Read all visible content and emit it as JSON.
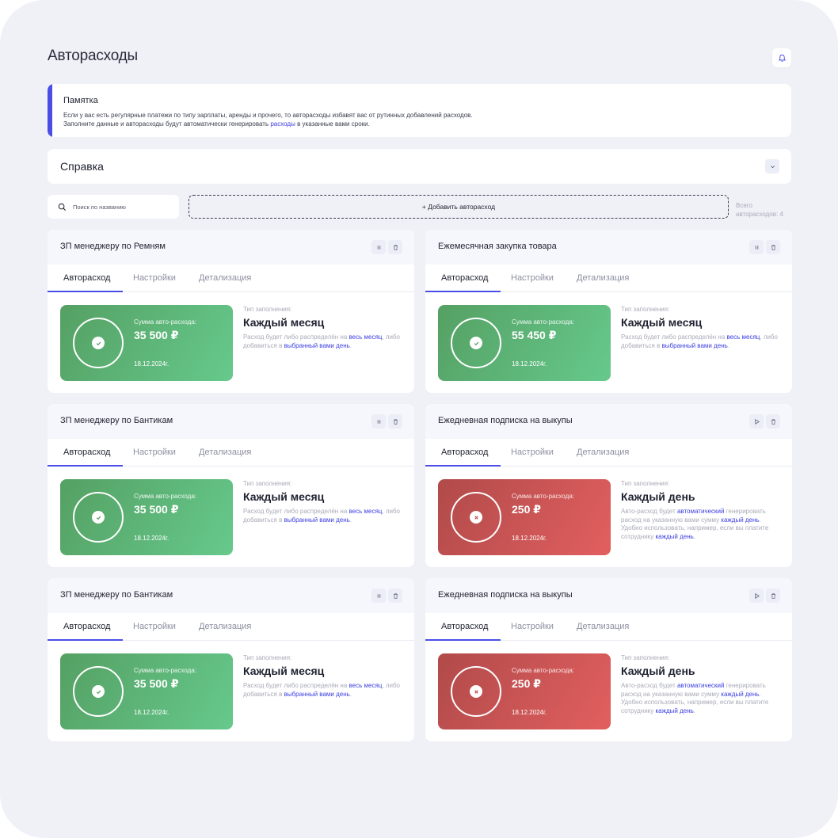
{
  "page": {
    "title": "Авторасходы"
  },
  "memo": {
    "title": "Памятка",
    "text_before": "Если у вас есть регулярные платежи по типу зарплаты, аренды и прочего, то авторасходы избавят вас от рутинных добавлений расходов. Заполните данные и авторасходы будут автоматически генерировать ",
    "link": "расходы",
    "text_after": " в указанные вами сроки."
  },
  "help": {
    "title": "Справка"
  },
  "toolbar": {
    "search_placeholder": "Поиск по названию",
    "add_label": "+ Добавить авторасход",
    "total_label": "Всего",
    "total_value": "авторасходов: 4"
  },
  "tabs": [
    "Авторасход",
    "Настройки",
    "Детализация"
  ],
  "labels": {
    "sum": "Сумма авто-расхода:",
    "fill_type": "Тип заполнения:"
  },
  "colors": {
    "accent": "#4a4de6",
    "ok_start": "#55a063",
    "ok_end": "#66c98c",
    "fail_start": "#b14a4a",
    "fail_end": "#e25f5f"
  },
  "cards": [
    {
      "title": "ЗП менеджеру по Ремням",
      "action_icon": "pause-icon",
      "status": "ok",
      "amount": "35 500 ₽",
      "date": "18.12.2024г.",
      "fill": "Каждый месяц",
      "desc": [
        {
          "t": "Расход будет либо распределён на ",
          "link": false
        },
        {
          "t": "весь месяц",
          "link": true
        },
        {
          "t": ", либо добавиться в ",
          "link": false
        },
        {
          "t": "выбранный вами день",
          "link": true
        },
        {
          "t": ".",
          "link": false
        }
      ]
    },
    {
      "title": "Ежемесячная закупка товара",
      "action_icon": "pause-icon",
      "status": "ok",
      "amount": "55 450 ₽",
      "date": "18.12.2024г.",
      "fill": "Каждый месяц",
      "desc": [
        {
          "t": "Расход будет либо распределён на ",
          "link": false
        },
        {
          "t": "весь месяц",
          "link": true
        },
        {
          "t": ", либо добавиться в ",
          "link": false
        },
        {
          "t": "выбранный вами день",
          "link": true
        },
        {
          "t": ".",
          "link": false
        }
      ]
    },
    {
      "title": "ЗП менеджеру по Бантикам",
      "action_icon": "pause-icon",
      "status": "ok",
      "amount": "35 500 ₽",
      "date": "18.12.2024г.",
      "fill": "Каждый месяц",
      "desc": [
        {
          "t": "Расход будет либо распределён на ",
          "link": false
        },
        {
          "t": "весь месяц",
          "link": true
        },
        {
          "t": ", либо добавиться в ",
          "link": false
        },
        {
          "t": "выбранный вами день",
          "link": true
        },
        {
          "t": ".",
          "link": false
        }
      ]
    },
    {
      "title": "Ежедневная подписка на выкупы",
      "action_icon": "play-icon",
      "status": "fail",
      "amount": "250 ₽",
      "date": "18.12.2024г.",
      "fill": "Каждый день",
      "desc": [
        {
          "t": "Авто-расход будет ",
          "link": false
        },
        {
          "t": "автоматический",
          "link": true
        },
        {
          "t": " генерировать расход на указанную вами сумму ",
          "link": false
        },
        {
          "t": "каждый день",
          "link": true
        },
        {
          "t": ". Удобно использовать, например, если вы платите сотруднику ",
          "link": false
        },
        {
          "t": "каждый день",
          "link": true
        },
        {
          "t": ".",
          "link": false
        }
      ]
    },
    {
      "title": "ЗП менеджеру по Бантикам",
      "action_icon": "pause-icon",
      "status": "ok",
      "amount": "35 500 ₽",
      "date": "18.12.2024г.",
      "fill": "Каждый месяц",
      "desc": [
        {
          "t": "Расход будет либо распределён на ",
          "link": false
        },
        {
          "t": "весь месяц",
          "link": true
        },
        {
          "t": ", либо добавиться в ",
          "link": false
        },
        {
          "t": "выбранный вами день",
          "link": true
        },
        {
          "t": ".",
          "link": false
        }
      ]
    },
    {
      "title": "Ежедневная подписка на выкупы",
      "action_icon": "play-icon",
      "status": "fail",
      "amount": "250 ₽",
      "date": "18.12.2024г.",
      "fill": "Каждый день",
      "desc": [
        {
          "t": "Авто-расход будет ",
          "link": false
        },
        {
          "t": "автоматический",
          "link": true
        },
        {
          "t": " генерировать расход на указанную вами сумму ",
          "link": false
        },
        {
          "t": "каждый день",
          "link": true
        },
        {
          "t": ". Удобно использовать, например, если вы платите сотруднику ",
          "link": false
        },
        {
          "t": "каждый день",
          "link": true
        },
        {
          "t": ".",
          "link": false
        }
      ]
    }
  ]
}
